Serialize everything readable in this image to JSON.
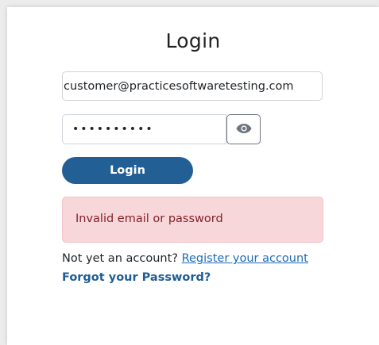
{
  "login": {
    "title": "Login",
    "email_value": "customer@practicesoftwaretesting.com",
    "password_value": "••••••••••",
    "show_password_icon": "eye-icon",
    "submit_label": "Login",
    "error_message": "Invalid email or password",
    "register_prompt": "Not yet an account?",
    "register_link": "Register your account",
    "forgot_link": "Forgot your Password?"
  },
  "colors": {
    "primary_button": "#225f94",
    "alert_background": "#f8d7da",
    "alert_text": "#842029",
    "link": "#1c6ab8"
  }
}
